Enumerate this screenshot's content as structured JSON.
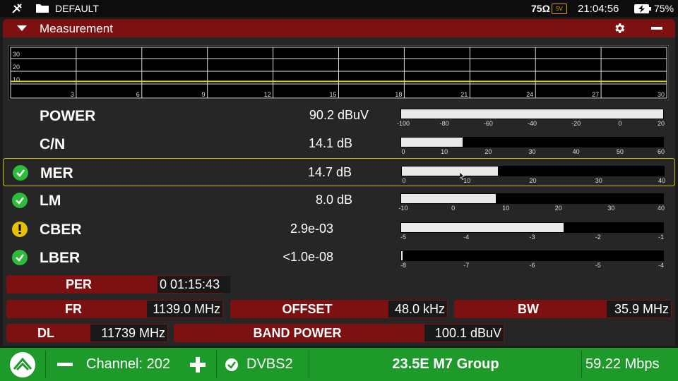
{
  "status": {
    "profile": "DEFAULT",
    "impedance": "75Ω",
    "voltage": "5V",
    "time": "21:04:56",
    "battery": "75%"
  },
  "header": {
    "title": "Measurement"
  },
  "graph": {
    "y_ticks": [
      "30",
      "20",
      "10"
    ],
    "x_ticks": [
      "3",
      "6",
      "9",
      "12",
      "15",
      "18",
      "21",
      "24",
      "27",
      "30"
    ],
    "level": 12
  },
  "rows": [
    {
      "name": "POWER",
      "value": "90.2 dBuV",
      "status": "none",
      "fill": 1.0,
      "ticks": [
        "-100",
        "-80",
        "-60",
        "-40",
        "-20",
        "0",
        "20"
      ]
    },
    {
      "name": "C/N",
      "value": "14.1 dB",
      "status": "none",
      "fill": 0.235,
      "ticks": [
        "0",
        "10",
        "20",
        "30",
        "40",
        "50",
        "60"
      ]
    },
    {
      "name": "MER",
      "value": "14.7 dB",
      "status": "ok",
      "fill": 0.3675,
      "ticks": [
        "0",
        "10",
        "20",
        "30",
        "40"
      ]
    },
    {
      "name": "LM",
      "value": "8.0 dB",
      "status": "ok",
      "fill": 0.36,
      "ticks": [
        "-10",
        "0",
        "10",
        "20",
        "30",
        "40"
      ]
    },
    {
      "name": "CBER",
      "value": "2.9e-03",
      "status": "warn",
      "fill": 0.62,
      "ticks": [
        "-5",
        "-4",
        "-3",
        "-2",
        "-1"
      ]
    },
    {
      "name": "LBER",
      "value": "<1.0e-08",
      "status": "ok",
      "fill": 0.005,
      "ticks": [
        "-8",
        "-7",
        "-6",
        "-5",
        "-4"
      ]
    }
  ],
  "info": {
    "per_label": "PER",
    "per_value": "0 01:15:43",
    "fr_label": "FR",
    "fr_value": "1139.0 MHz",
    "offset_label": "OFFSET",
    "offset_value": "48.0 kHz",
    "bw_label": "BW",
    "bw_value": "35.9 MHz",
    "dl_label": "DL",
    "dl_value": "11739 MHz",
    "bandpower_label": "BAND POWER",
    "bandpower_value": "100.1 dBuV"
  },
  "bottom": {
    "channel": "Channel: 202",
    "standard": "DVBS2",
    "service": "23.5E M7 Group",
    "bitrate": "59.22 Mbps"
  },
  "colors": {
    "accent": "#7d1111",
    "ok": "#2dbb3a",
    "warn": "#e6c200",
    "bottom": "#1e9a2b",
    "trace": "#d4cc2a"
  }
}
